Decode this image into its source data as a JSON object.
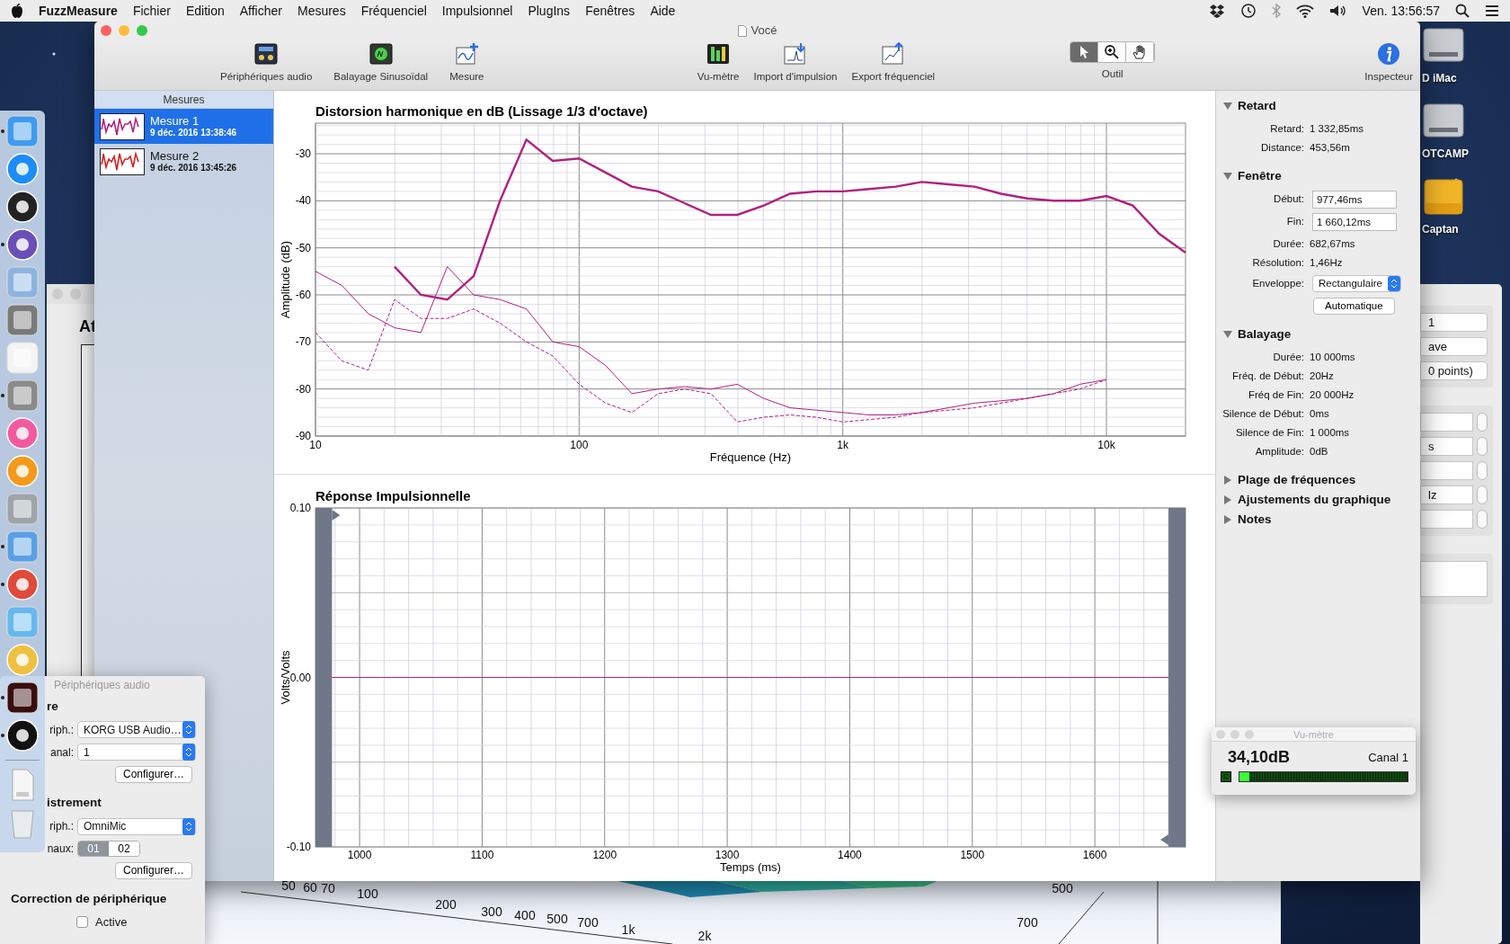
{
  "menubar": {
    "app": "FuzzMeasure",
    "menus": [
      "Fichier",
      "Edition",
      "Afficher",
      "Mesures",
      "Fréquenciel",
      "Impulsionnel",
      "PlugIns",
      "Fenêtres",
      "Aide"
    ],
    "clock": "Ven. 13:56:57"
  },
  "desktop_icons": [
    {
      "label": "D iMac",
      "kind": "disk"
    },
    {
      "label": "OTCAMP",
      "kind": "disk"
    },
    {
      "label": "Captan",
      "kind": "folder"
    }
  ],
  "dock": {
    "items": [
      {
        "kind": "finder",
        "running": true
      },
      {
        "kind": "appstore",
        "running": false
      },
      {
        "kind": "dashboard",
        "running": false
      },
      {
        "kind": "quill",
        "running": true
      },
      {
        "kind": "preview",
        "running": false
      },
      {
        "kind": "settings",
        "running": false
      },
      {
        "kind": "textedit",
        "running": false
      },
      {
        "kind": "calculator",
        "running": true
      },
      {
        "kind": "music",
        "running": false
      },
      {
        "kind": "books",
        "running": false
      },
      {
        "kind": "diskutil",
        "running": false
      },
      {
        "kind": "mail",
        "running": true
      },
      {
        "kind": "browser",
        "running": true
      },
      {
        "kind": "maps",
        "running": false
      },
      {
        "kind": "photos",
        "running": false
      },
      {
        "kind": "acrobat",
        "running": true
      },
      {
        "kind": "speaker",
        "running": true
      }
    ],
    "documents": [
      {
        "kind": "pdf"
      },
      {
        "kind": "trash"
      }
    ]
  },
  "left_window": {
    "title": "At"
  },
  "right_window": {
    "popups": [
      "1",
      "ave",
      "0 points)"
    ],
    "steppers": [
      {
        "kind": "stepper"
      },
      {
        "kind": "stepper",
        "value": "s"
      },
      {
        "kind": "stepper"
      },
      {
        "kind": "stepper",
        "value": "lz"
      },
      {
        "kind": "stepper"
      }
    ]
  },
  "waterfall": {
    "freq_labels": [
      "50",
      "60",
      "70",
      "100",
      "200",
      "300",
      "400",
      "500",
      "700",
      "1k",
      "2k"
    ],
    "depth_labels": [
      "500",
      "700"
    ]
  },
  "main_window": {
    "title": "Vocé",
    "toolbar": {
      "left": [
        {
          "label": "Périphériques audio",
          "kind": "devices"
        },
        {
          "label": "Balayage Sinusoïdal",
          "kind": "sweep"
        },
        {
          "label": "Mesure",
          "kind": "measure"
        }
      ],
      "center": [
        {
          "label": "Vu-mètre",
          "kind": "meter"
        },
        {
          "label": "Import d'impulsion",
          "kind": "import"
        },
        {
          "label": "Export fréquenciel",
          "kind": "export"
        }
      ],
      "tool": {
        "label": "Outil",
        "buttons": [
          {
            "kind": "pointer",
            "selected": true
          },
          {
            "kind": "zoom",
            "selected": false
          },
          {
            "kind": "hand",
            "selected": false
          }
        ]
      },
      "inspector": "Inspecteur"
    },
    "sidebar": {
      "header": "Mesures",
      "items": [
        {
          "name": "Mesure 1",
          "date": "9 déc. 2016 13:38:46",
          "selected": true,
          "color": "#b0217f"
        },
        {
          "name": "Mesure 2",
          "date": "9 déc. 2016 13:45:26",
          "selected": false,
          "color": "#d42020"
        }
      ]
    },
    "charts": [
      {
        "chart_data": {
          "type": "line",
          "title": "Distorsion harmonique en dB (Lissage 1/3 d'octave)",
          "xlabel": "Fréquence (Hz)",
          "ylabel": "Amplitude (dB)",
          "grid": true,
          "ylim": [
            -90,
            -23.5
          ],
          "categories": [
            "10",
            null,
            null,
            null,
            null,
            null,
            null,
            null,
            null,
            null,
            "100",
            null,
            null,
            null,
            null,
            null,
            null,
            null,
            null,
            null,
            "1k",
            null,
            null,
            null,
            null,
            null,
            null,
            null,
            null,
            null,
            "10k",
            null,
            null,
            null
          ],
          "yticks": [
            -30,
            -40,
            -50,
            -60,
            -70,
            -80,
            -90
          ],
          "series": [
            {
              "color": "#b0217f",
              "values": [
                null,
                null,
                null,
                -54,
                -60,
                -61,
                -56,
                -40,
                -27,
                -31.5,
                -31,
                -34,
                -37,
                -38,
                -40.5,
                -43,
                -43,
                -41,
                -38.5,
                -38,
                -38,
                -37.5,
                -37,
                -36,
                -36.5,
                -37,
                -38.5,
                -39.5,
                -40,
                -40,
                -39,
                -41,
                -47,
                -51
              ]
            },
            {
              "color": "#b0217f",
              "values": [
                -55,
                -58,
                -64,
                -67,
                -68,
                -54,
                -60,
                -61,
                -63,
                -70,
                -71,
                -75,
                -81,
                -80,
                -79.5,
                -80,
                -79,
                -82,
                -84,
                -84.5,
                -85,
                -85.5,
                -85.5,
                -85,
                -84,
                -83,
                -82.5,
                -82,
                -81,
                -79,
                -78,
                null,
                null,
                null
              ]
            },
            {
              "color": "#b0217f",
              "line_style": "dashed",
              "values": [
                -68,
                -74,
                -76,
                -61,
                -65,
                -65,
                -63,
                -66,
                -70,
                -73,
                -79,
                -83,
                -85,
                -81,
                -80,
                -81,
                -87,
                -86,
                -85.5,
                -86,
                -87,
                -86.5,
                -86,
                -85,
                -84.5,
                -84,
                -83,
                -82,
                -81,
                -80,
                -78,
                null,
                null,
                null
              ]
            }
          ]
        }
      },
      {
        "chart_data": {
          "type": "line",
          "title": "Réponse Impulsionnelle",
          "xlabel": "Temps (ms)",
          "ylabel": "Volts/Volts",
          "grid": true,
          "xlim": [
            964,
            1674
          ],
          "ylim": [
            -0.1,
            0.1
          ],
          "xticks": [
            1000,
            1100,
            1200,
            1300,
            1400,
            1500,
            1600
          ],
          "yticks": [
            {
              "value": 0.1,
              "label": "0.10"
            },
            {
              "value": 0,
              "label": "0.00"
            },
            {
              "value": -0.1,
              "label": "-0.10"
            }
          ],
          "x": [
            977.46,
            1660.12
          ],
          "series": [
            {
              "color": "#b0217f",
              "values": [
                0,
                0
              ]
            }
          ]
        }
      }
    ],
    "inspector": {
      "sections": [
        {
          "title": "Retard",
          "expanded": true,
          "rows": [
            {
              "kind": "value",
              "label": "Retard:",
              "value": "1 332,85ms"
            },
            {
              "kind": "value",
              "label": "Distance:",
              "value": "453,56m"
            }
          ]
        },
        {
          "title": "Fenêtre",
          "expanded": true,
          "rows": [
            {
              "kind": "field",
              "label": "Début:",
              "value": "977,46ms"
            },
            {
              "kind": "field",
              "label": "Fin:",
              "value": "1 660,12ms"
            },
            {
              "kind": "value",
              "label": "Durée:",
              "value": "682,67ms"
            },
            {
              "kind": "value",
              "label": "Résolution:",
              "value": "1,46Hz"
            },
            {
              "kind": "popup",
              "label": "Enveloppe:",
              "value": "Rectangulaire"
            },
            {
              "kind": "button",
              "value": "Automatique"
            }
          ]
        },
        {
          "title": "Balayage",
          "expanded": true,
          "rows": [
            {
              "kind": "value",
              "label": "Durée:",
              "value": "10 000ms"
            },
            {
              "kind": "value",
              "label": "Fréq. de Début:",
              "value": "20Hz"
            },
            {
              "kind": "value",
              "label": "Fréq de Fin:",
              "value": "20 000Hz"
            },
            {
              "kind": "value",
              "label": "Silence de Début:",
              "value": "0ms"
            },
            {
              "kind": "value",
              "label": "Silence de Fin:",
              "value": "1 000ms"
            },
            {
              "kind": "value",
              "label": "Amplitude:",
              "value": "0dB"
            }
          ]
        },
        {
          "title": "Plage de fréquences",
          "expanded": false
        },
        {
          "title": "Ajustements du graphique",
          "expanded": false
        },
        {
          "title": "Notes",
          "expanded": false
        }
      ]
    }
  },
  "vu_meter": {
    "title": "Vu-mètre",
    "reading": "34,10dB",
    "channel": "Canal 1",
    "clip": "C",
    "level": 0.06
  },
  "audio_panel": {
    "title": "Périphériques audio",
    "sections": [
      {
        "title": "re",
        "rows": [
          {
            "kind": "popup",
            "label": "riph.:",
            "value": "KORG USB Audio…"
          },
          {
            "kind": "popup",
            "label": "anal:",
            "value": "1"
          },
          {
            "kind": "button",
            "value": "Configurer…"
          }
        ]
      },
      {
        "title": "istrement",
        "rows": [
          {
            "kind": "popup",
            "label": "riph.:",
            "value": "OmniMic"
          },
          {
            "kind": "segments",
            "label": "naux:",
            "segments": [
              {
                "label": "01",
                "selected": true
              },
              {
                "label": "02",
                "selected": false
              }
            ]
          },
          {
            "kind": "button",
            "value": "Configurer…"
          }
        ]
      },
      {
        "title": "Correction de périphérique",
        "rows": [
          {
            "kind": "checkbox",
            "label": "Active",
            "checked": false
          }
        ]
      }
    ]
  }
}
